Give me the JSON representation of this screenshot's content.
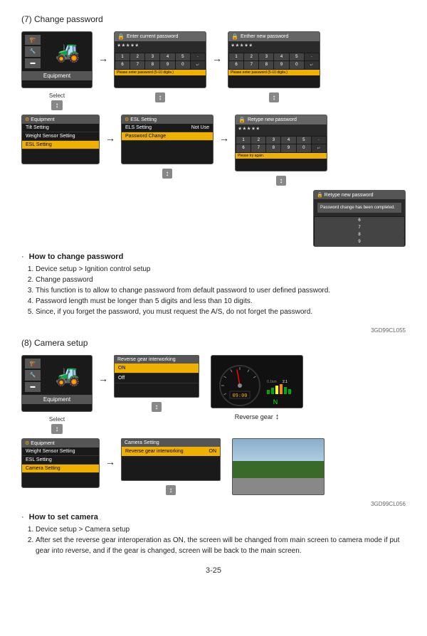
{
  "section1": {
    "title": "(7) Change password",
    "diagrams": {
      "screen1_label": "Equipment",
      "select_label": "Select",
      "menu1_title": "Equipment",
      "menu1_items": [
        "Tilt Setting",
        "Weight Sensor Setting",
        "ESL Setting"
      ],
      "menu1_selected": "ESL Setting",
      "kb_enter_title": "Enter current password",
      "kb_dots": "*****",
      "kb_hint": "Please enter password (5-10 digits.)",
      "esl_title": "ESL Setting",
      "esl_items": [
        {
          "label": "ELS Setting",
          "value": "Not Use"
        },
        {
          "label": "Password Change",
          "value": ""
        }
      ],
      "esl_selected": "Password Change",
      "kb_enter_new_title": "Enther new password",
      "kb_retype_title": "Retype new password",
      "confirm_title": "Retype new password",
      "confirm_msg": "Password change has been completed."
    },
    "how_to_title": "How to change password",
    "how_to_items": [
      "Device setup > Ignition control setup",
      "Change password",
      "This function is to allow to change password from default password to user defined password.",
      "Password length must be longer than 5 digits and less than 10 digits.",
      "Since, if you forget the password, you must request the A/S, do not forget the password."
    ],
    "reference_code": "3GD99CL055"
  },
  "section2": {
    "title": "(8) Camera setup",
    "diagrams": {
      "screen1_label": "Equipment",
      "select_label": "Select",
      "menu1_title": "Equipment",
      "menu1_items": [
        "Weight Sensor Setting",
        "ESL Setting",
        "Camera Setting"
      ],
      "menu1_selected": "Camera Setting",
      "iw_title": "Reverse gear interworking",
      "iw_items": [
        "ON",
        "Off"
      ],
      "iw_selected": "ON",
      "cs_title": "Camera Setting",
      "cs_item": "Reverse gear interworking",
      "cs_value": "ON",
      "reverse_gear_label": "Reverse gear"
    },
    "how_to_title": "How to set camera",
    "how_to_items": [
      "Device setup > Camera setup",
      "After set the reverse gear interoperation as ON, the screen will be changed from main screen to camera mode if put gear into reverse, and if the gear is changed, screen will be back to the main screen."
    ],
    "reference_code": "3GD99CL056"
  },
  "page_number": "3-25"
}
